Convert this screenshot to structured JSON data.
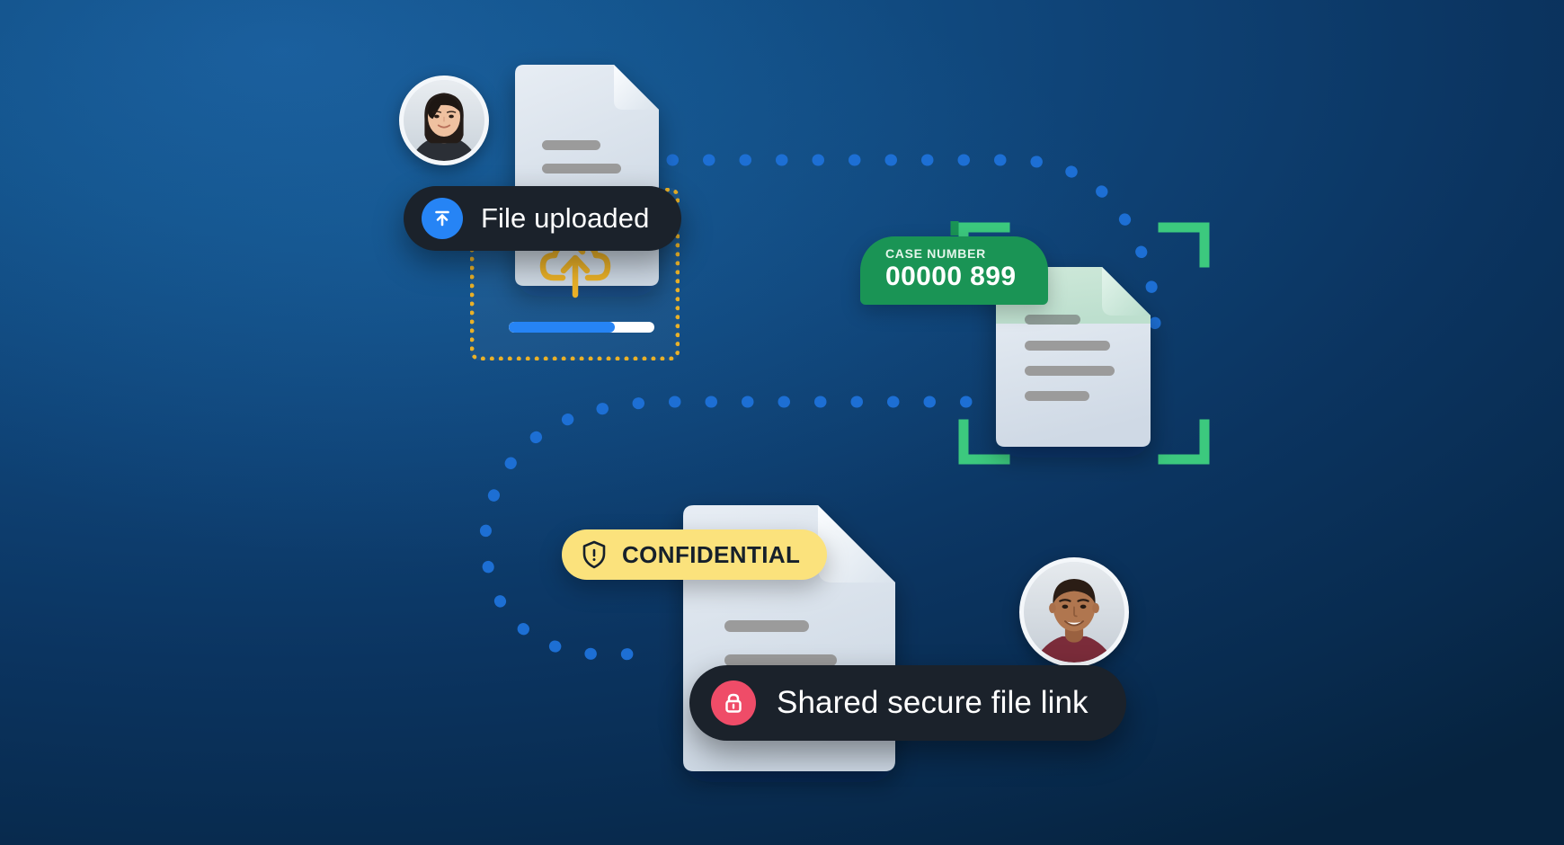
{
  "scene": {
    "title": "Secure file upload, case scanning and sharing illustration",
    "background": {
      "gradient_from": "#1a5e9c",
      "gradient_to": "#06233f"
    }
  },
  "colors": {
    "accent_blue": "#2684f5",
    "dot_blue": "#1d6fd4",
    "amber": "#eab128",
    "green": "#1a9455",
    "scan_green": "#2ce07a",
    "bracket_green": "#3cc97e",
    "pink": "#ef4c68",
    "yellow": "#fbe27c",
    "toast_dark": "#1b222b",
    "paper": "#dde5ee",
    "paper_light": "#eef3f8",
    "paper_green": "#c6e6d6",
    "text_line_gray": "#9b9b9b"
  },
  "avatars": [
    {
      "name": "uploader-avatar",
      "alt": "Photo of a smiling woman with dark hair"
    },
    {
      "name": "recipient-avatar",
      "alt": "Photo of a smiling man with short hair"
    }
  ],
  "upload": {
    "toast": {
      "label": "File uploaded",
      "icon": "upload-arrow-icon",
      "icon_color": "#2684f5"
    },
    "dropzone": {
      "icon": "cloud-upload-icon",
      "border_style": "dotted",
      "border_color": "#eab128"
    },
    "progress": {
      "percent": 73,
      "fill_color": "#2684f5",
      "track_color": "#ffffff"
    }
  },
  "scan": {
    "badge": {
      "label": "CASE NUMBER",
      "value": "00000 899",
      "background": "#1a9455"
    },
    "scan_line_color": "#2ce07a",
    "brackets": "scan-corner-brackets",
    "document_lines": 4
  },
  "share": {
    "badge": {
      "label": "CONFIDENTIAL",
      "icon": "shield-alert-icon",
      "background": "#fbe27c",
      "text_color": "#16202b"
    },
    "toast": {
      "label": "Shared secure file link",
      "icon": "lock-icon",
      "icon_color": "#ef4c68"
    },
    "document_lines": 2
  },
  "documents": [
    {
      "name": "uploaded-document",
      "lines": 3,
      "folded_corner": true
    },
    {
      "name": "scanned-document",
      "lines": 4,
      "folded_corner": true
    },
    {
      "name": "shared-document",
      "lines": 2,
      "folded_corner": true
    }
  ],
  "connectors": [
    {
      "name": "upload-to-scan-path",
      "style": "dotted",
      "color": "#1d6fd4"
    },
    {
      "name": "scan-to-share-path",
      "style": "dotted",
      "color": "#1d6fd4"
    }
  ]
}
